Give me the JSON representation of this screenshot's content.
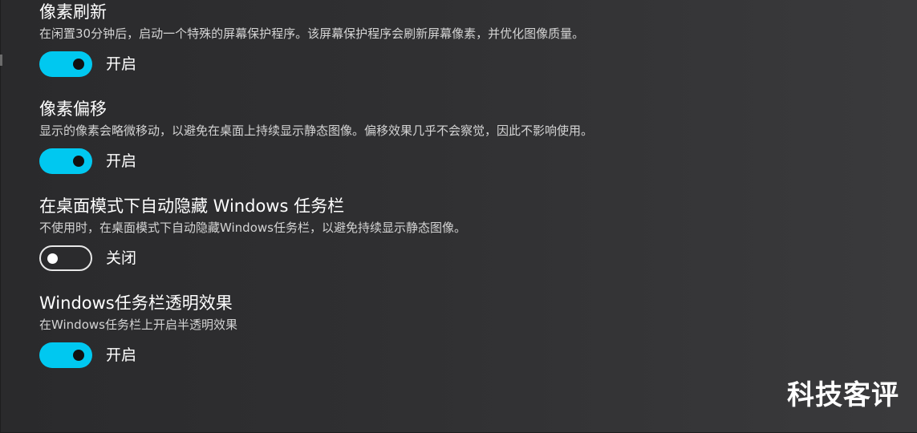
{
  "settings": [
    {
      "title": "像素刷新",
      "description": "在闲置30分钟后，启动一个特殊的屏幕保护程序。该屏幕保护程序会刷新屏幕像素，并优化图像质量。",
      "toggle_state": "on",
      "toggle_label": "开启"
    },
    {
      "title": "像素偏移",
      "description": "显示的像素会略微移动，以避免在桌面上持续显示静态图像。偏移效果几乎不会察觉，因此不影响使用。",
      "toggle_state": "on",
      "toggle_label": "开启"
    },
    {
      "title": "在桌面模式下自动隐藏 Windows 任务栏",
      "description": "不使用时，在桌面模式下自动隐藏Windows任务栏，以避免持续显示静态图像。",
      "toggle_state": "off",
      "toggle_label": "关闭"
    },
    {
      "title": "Windows任务栏透明效果",
      "description": "在Windows任务栏上开启半透明效果",
      "toggle_state": "on",
      "toggle_label": "开启"
    }
  ],
  "watermark": "科技客评",
  "colors": {
    "toggle_on": "#00c8f0",
    "background": "#2f2f31",
    "text": "#ffffff",
    "description_text": "#d4d4d4"
  }
}
